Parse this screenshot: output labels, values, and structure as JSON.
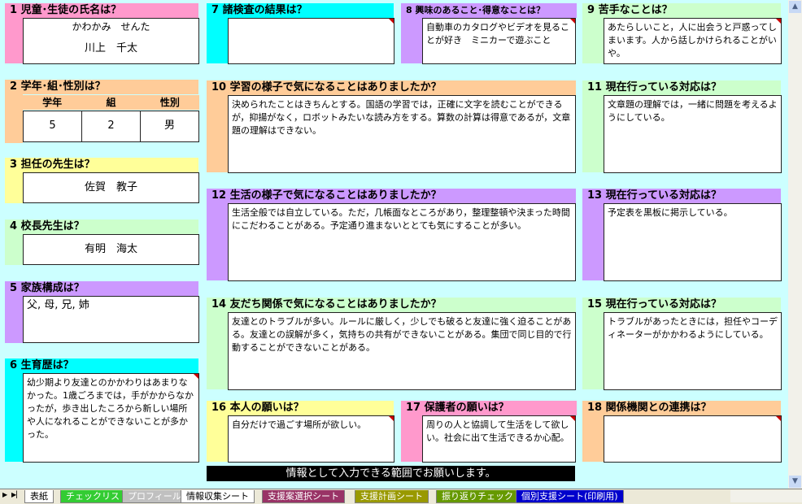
{
  "sections": {
    "s1": {
      "num": "1",
      "title": "児童･生徒の氏名は？",
      "furigana": "かわかみ　せんた",
      "name": "川上　千太"
    },
    "s2": {
      "num": "2",
      "title": "学年･組･性別は？",
      "headers": [
        "学年",
        "組",
        "性別"
      ],
      "values": [
        "5",
        "2",
        "男"
      ]
    },
    "s3": {
      "num": "3",
      "title": "担任の先生は？",
      "value": "佐賀　教子"
    },
    "s4": {
      "num": "4",
      "title": "校長先生は？",
      "value": "有明　海太"
    },
    "s5": {
      "num": "5",
      "title": "家族構成は？",
      "value": "父, 母, 兄, 姉"
    },
    "s6": {
      "num": "6",
      "title": "生育歴は？",
      "value": "幼少期より友達とのかかわりはあまりなかった。1歳ごろまでは，手がかからなかったが，歩き出したころから新しい場所や人になれることができないことが多かった。"
    },
    "s7": {
      "num": "7",
      "title": "諸検査の結果は？",
      "value": ""
    },
    "s8": {
      "num": "8",
      "title": "興味のあること･得意なことは？",
      "value": "自動車のカタログやビデオを見ることが好き　ミニカーで遊ぶこと"
    },
    "s9": {
      "num": "9",
      "title": "苦手なことは？",
      "value": "あたらしいこと，人に出会うと戸惑ってしまいます。人から話しかけられることがいや。"
    },
    "s10": {
      "num": "10",
      "title": "学習の様子で気になることはありましたか？",
      "value": "決められたことはきちんとする。国語の学習では，正確に文字を読むことができるが，抑揚がなく，ロボットみたいな読み方をする。算数の計算は得意であるが，文章題の理解はできない。"
    },
    "s11": {
      "num": "11",
      "title": "現在行っている対応は？",
      "value": "文章題の理解では，一緒に問題を考えるようにしている。"
    },
    "s12": {
      "num": "12",
      "title": "生活の様子で気になることはありましたか？",
      "value": "生活全般では自立している。ただ，几帳面なところがあり，整理整頓や決まった時間にこだわることがある。予定通り進まないととても気にすることが多い。"
    },
    "s13": {
      "num": "13",
      "title": "現在行っている対応は？",
      "value": "予定表を黒板に掲示している。"
    },
    "s14": {
      "num": "14",
      "title": "友だち関係で気になることはありましたか？",
      "value": "友達とのトラブルが多い。ルールに厳しく，少しでも破ると友達に強く迫ることがある。友達との誤解が多く，気持ちの共有ができないことがある。集団で同じ目的で行動することができないことがある。"
    },
    "s15": {
      "num": "15",
      "title": "現在行っている対応は？",
      "value": "トラブルがあったときには，担任やコーディネーターがかかわるようにしている。"
    },
    "s16": {
      "num": "16",
      "title": "本人の願いは？",
      "value": "自分だけで過ごす場所が欲しい。"
    },
    "s17": {
      "num": "17",
      "title": "保護者の願いは？",
      "value": "周りの人と協調して生活をして欲しい。社会に出て生活できるか心配。"
    },
    "s18": {
      "num": "18",
      "title": "関係機関との連携は？",
      "value": ""
    }
  },
  "banner": "情報として入力できる範囲でお願いします。",
  "sheet_tabs": [
    {
      "label": "表紙",
      "color": "#ffffff"
    },
    {
      "label": "チェックリスト",
      "color": "#33cc33"
    },
    {
      "label": "プロフィール",
      "color": "#c0c0c0"
    },
    {
      "label": "情報収集シート",
      "color": "#ffffff"
    },
    {
      "label": "支援案選択シート",
      "color": "#993366"
    },
    {
      "label": "支援計画シート",
      "color": "#999900"
    },
    {
      "label": "振り返りチェック",
      "color": "#669900"
    },
    {
      "label": "個別支援シート(印刷用)",
      "color": "#0000cc"
    }
  ],
  "colors": {
    "background": "#ccffff",
    "pink": "#ff99cc",
    "cyan": "#00ffff",
    "lavender": "#cc99ff",
    "mint": "#ccffcc",
    "peach": "#ffcc99",
    "yellow": "#ffff99"
  }
}
